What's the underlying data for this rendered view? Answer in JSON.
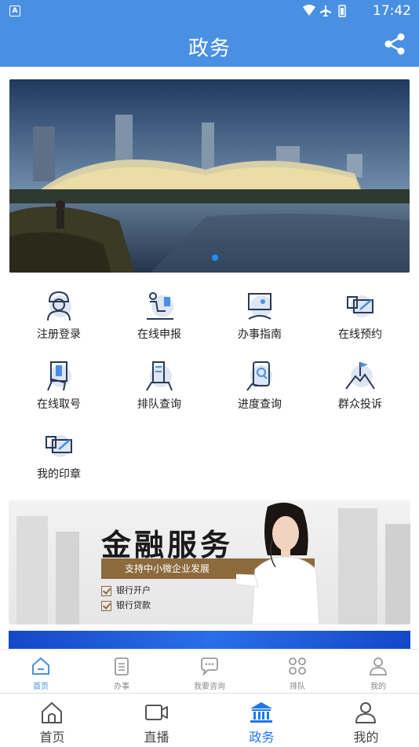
{
  "status_bar": {
    "time": "17:42",
    "notification_letter": "A"
  },
  "header": {
    "title": "政务"
  },
  "banner": {
    "active_slide": 1
  },
  "services": [
    {
      "label": "注册登录",
      "icon": "user-helmet-icon"
    },
    {
      "label": "在线申报",
      "icon": "desk-worker-icon"
    },
    {
      "label": "办事指南",
      "icon": "presentation-board-icon"
    },
    {
      "label": "在线预约",
      "icon": "card-pen-icon"
    },
    {
      "label": "在线取号",
      "icon": "ticket-hand-icon"
    },
    {
      "label": "排队查询",
      "icon": "building-hand-icon"
    },
    {
      "label": "进度查询",
      "icon": "phone-search-icon"
    },
    {
      "label": "群众投诉",
      "icon": "mountain-flag-icon"
    },
    {
      "label": "我的印章",
      "icon": "card-pen-icon"
    }
  ],
  "promo": {
    "headline": "金融服务",
    "ribbon": "支持中小微企业发展",
    "items": [
      "银行开户",
      "银行贷款"
    ]
  },
  "inner_tabs": [
    {
      "label": "首页",
      "icon": "home-icon",
      "active": true
    },
    {
      "label": "办事",
      "icon": "clipboard-icon",
      "active": false
    },
    {
      "label": "我要咨询",
      "icon": "chat-bubble-icon",
      "active": false
    },
    {
      "label": "排队",
      "icon": "command-icon",
      "active": false
    },
    {
      "label": "我的",
      "icon": "person-icon",
      "active": false
    }
  ],
  "bottom_nav": [
    {
      "label": "首页",
      "icon": "home-icon",
      "active": false
    },
    {
      "label": "直播",
      "icon": "video-camera-icon",
      "active": false
    },
    {
      "label": "政务",
      "icon": "government-building-icon",
      "active": true
    },
    {
      "label": "我的",
      "icon": "person-icon",
      "active": false
    }
  ],
  "colors": {
    "primary": "#4a90e2",
    "active_nav": "#1e78f0",
    "promo_gold": "#8c6a3c"
  }
}
